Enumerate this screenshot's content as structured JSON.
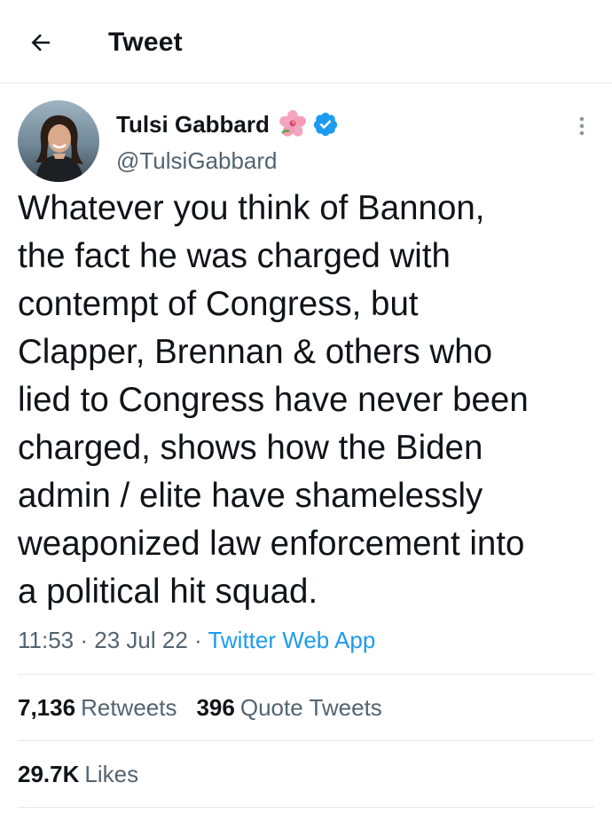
{
  "header": {
    "title": "Tweet",
    "back_icon": "arrow-left-icon"
  },
  "author": {
    "display_name": "Tulsi Gabbard",
    "handle": "@TulsiGabbard",
    "emoji_icon": "hibiscus-icon",
    "verified_icon": "verified-badge-icon",
    "verified_color": "#1d9bf0"
  },
  "tweet": {
    "text": "Whatever you think of Bannon,\nthe fact he was charged with\ncontempt of Congress, but\nClapper, Brennan & others who\nlied to Congress have never been\ncharged, shows how the Biden\nadmin / elite have shamelessly\nweaponized law enforcement into\na political hit squad.",
    "time": "11:53",
    "separator": "·",
    "date": "23 Jul 22",
    "source": "Twitter Web App"
  },
  "stats": {
    "retweets_count": "7,136",
    "retweets_label": "Retweets",
    "quotes_count": "396",
    "quotes_label": "Quote Tweets",
    "likes_count": "29.7K",
    "likes_label": "Likes"
  },
  "colors": {
    "text": "#0f1419",
    "secondary": "#536471",
    "link": "#1d9bf0",
    "divider": "#e6e9ea"
  }
}
